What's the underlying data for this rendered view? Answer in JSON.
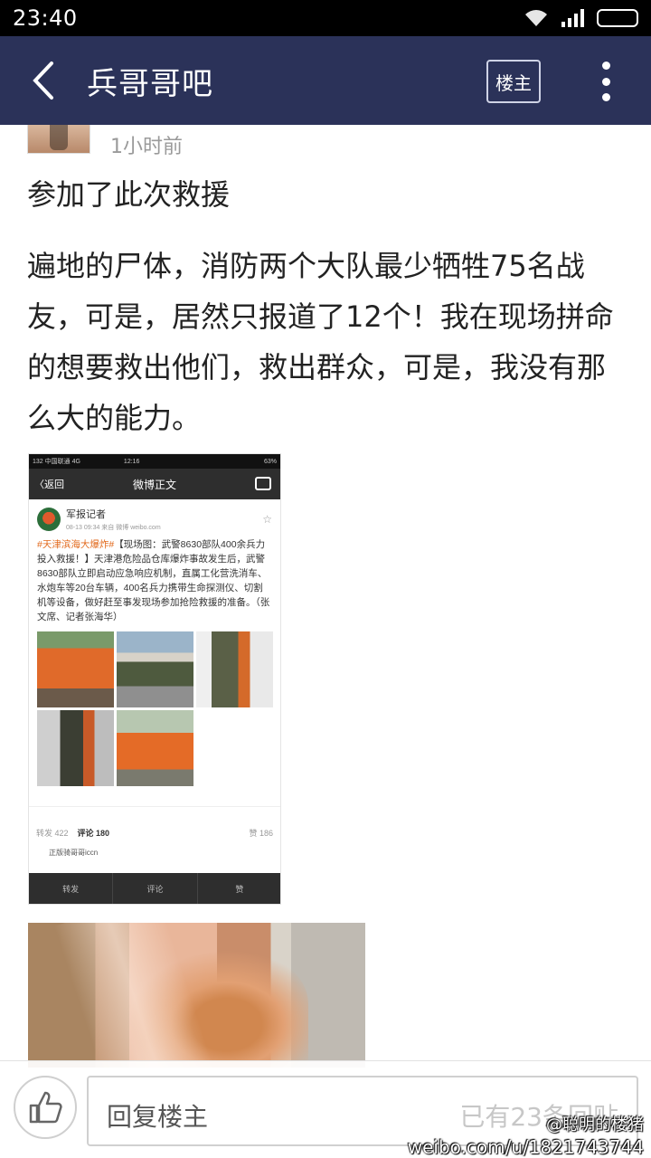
{
  "status_bar": {
    "time": "23:40"
  },
  "header": {
    "title": "兵哥哥吧",
    "owner_button": "楼主"
  },
  "post": {
    "time": "1小时前",
    "line1": "参加了此次救援",
    "body": "遍地的尸体，消防两个大队最少牺牲75名战友，可是，居然只报道了12个！我在现场拼命的想要救出他们，救出群众，可是，我没有那么大的能力。"
  },
  "embedded_weibo": {
    "status_left": "132 中国联通  4G",
    "status_time": "12:16",
    "status_right": "63%",
    "back_label": "〈返回",
    "nav_title": "微博正文",
    "user_name": "军报记者",
    "meta": "08-13 09:34  来自 微博 weibo.com",
    "hashtag": "#天津滨海大爆炸#",
    "text": "【现场图：武警8630部队400余兵力投入救援！】天津港危险品仓库爆炸事故发生后，武警8630部队立即启动应急响应机制，直属工化营洗消车、水炮车等20台车辆，400名兵力携带生命探测仪、切割机等设备，做好赶至事发现场参加抢险救援的准备。（张文席、记者张海华）",
    "stat_repost": "转发 422",
    "stat_comment": "评论 180",
    "stat_like": "赞 186",
    "reply_preview": "正版骑哥哥iccn",
    "tab_repost": "转发",
    "tab_comment": "评论",
    "tab_like": "赞"
  },
  "reply_bar": {
    "placeholder": "回复楼主",
    "count_text": "已有23条回贴"
  },
  "watermark": {
    "line1": "@聪明的楼猪",
    "line2": "weibo.com/u/1821743744"
  },
  "colors": {
    "header_bg": "#2b3259",
    "status_bg": "#000000",
    "text": "#222222",
    "muted": "#9a9a9a"
  }
}
